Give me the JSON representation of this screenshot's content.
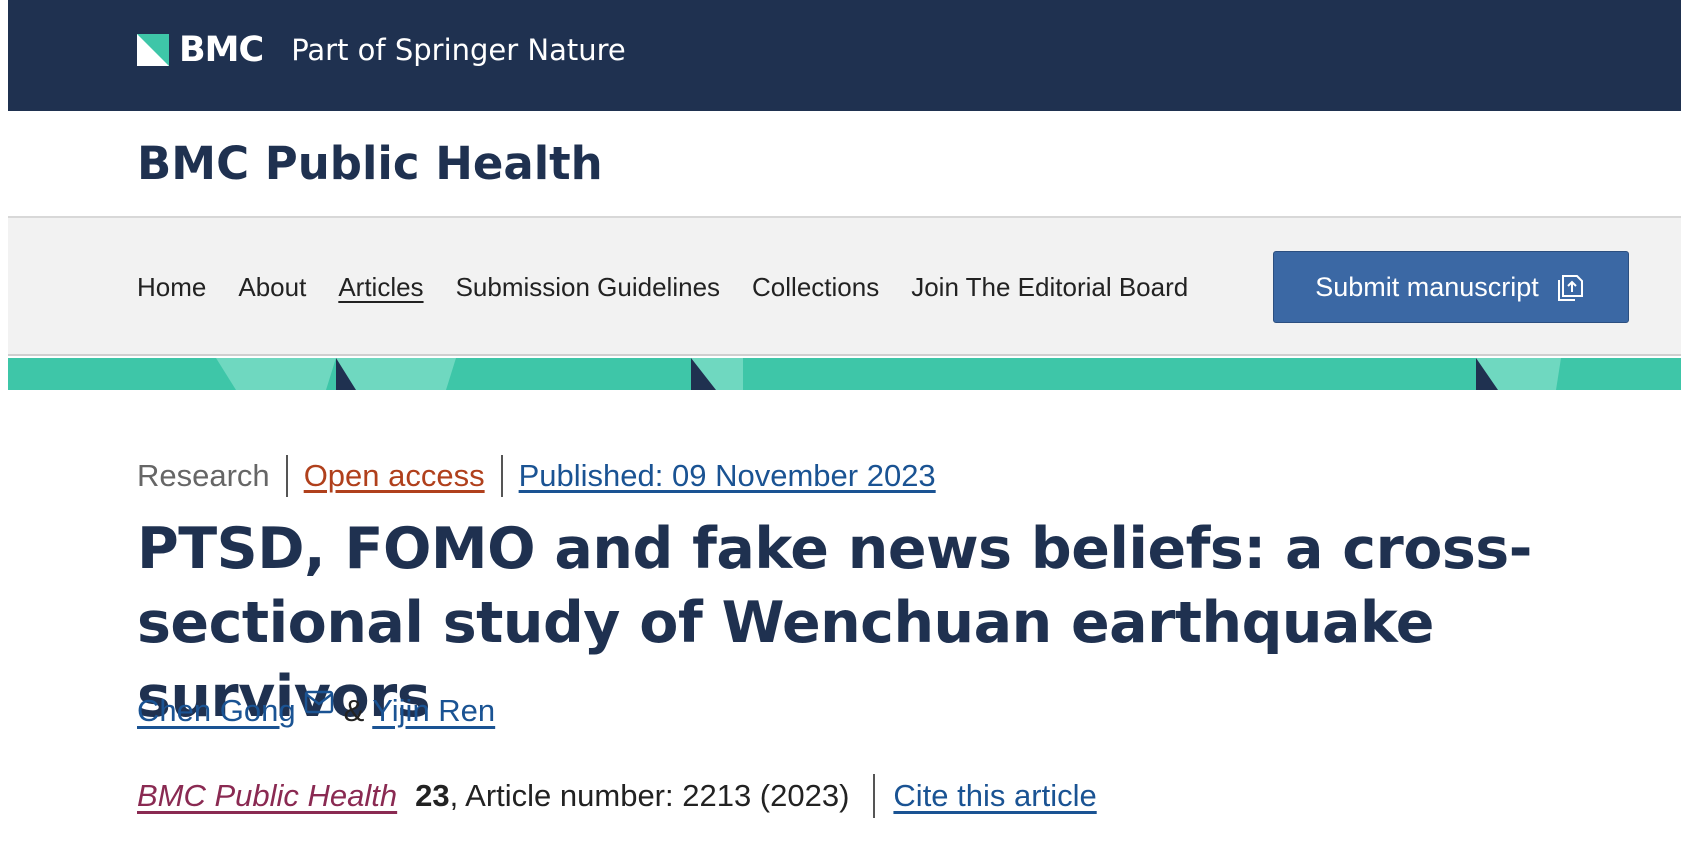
{
  "header": {
    "brand": "BMC",
    "brand_sub": "Part of Springer Nature"
  },
  "journal": {
    "title": "BMC Public Health"
  },
  "nav": {
    "items": [
      "Home",
      "About",
      "Articles",
      "Submission Guidelines",
      "Collections",
      "Join The Editorial Board"
    ],
    "active": "Articles",
    "submit_label": "Submit manuscript"
  },
  "article": {
    "type": "Research",
    "access": "Open access",
    "published": "Published: 09 November 2023",
    "title": "PTSD, FOMO and fake news beliefs: a cross-sectional study of Wenchuan earthquake survivors",
    "authors": [
      "Chen Gong",
      "Yijin Ren"
    ],
    "author_separator": "&",
    "citation": {
      "journal": "BMC Public Health",
      "volume": "23",
      "rest": ", Article number: 2213 (2023)",
      "cite_label": "Cite this article"
    }
  },
  "colors": {
    "navy": "#1f3150",
    "teal": "#3ec6a8",
    "button": "#3b68a4",
    "link": "#1a5393",
    "open_access": "#b0401c",
    "journal_link": "#8a2a52"
  },
  "icons": {
    "logo": "bmc-logo-icon",
    "submit": "upload-document-icon",
    "email": "mail-icon"
  }
}
